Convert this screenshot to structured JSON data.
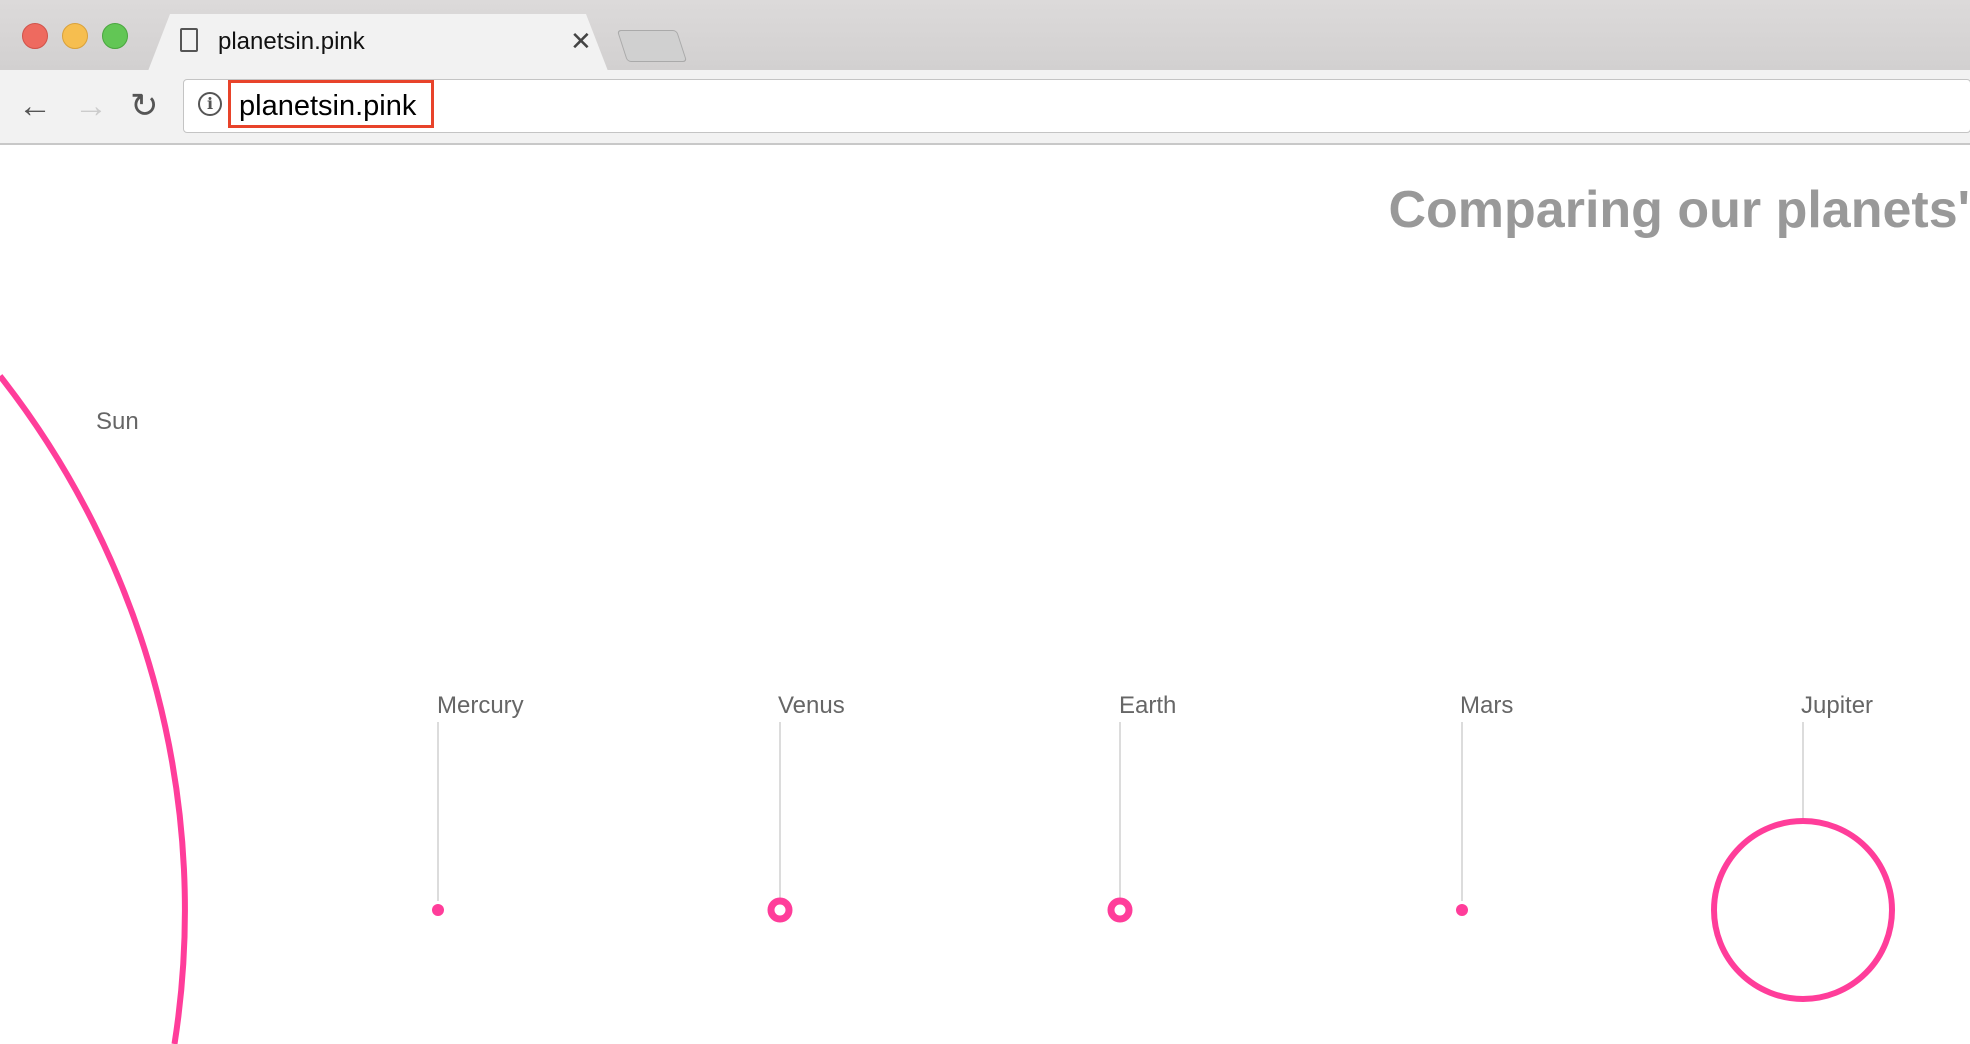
{
  "browser": {
    "tab_title": "planetsin.pink",
    "url": "planetsin.pink"
  },
  "page": {
    "title": "Comparing our planets'",
    "accent_color": "#ff3d9a",
    "sun_label": "Sun",
    "planets": [
      {
        "name": "Mercury",
        "marker": "dot"
      },
      {
        "name": "Venus",
        "marker": "ring"
      },
      {
        "name": "Earth",
        "marker": "ring"
      },
      {
        "name": "Mars",
        "marker": "dot"
      },
      {
        "name": "Jupiter",
        "marker": "large-circle"
      }
    ]
  }
}
